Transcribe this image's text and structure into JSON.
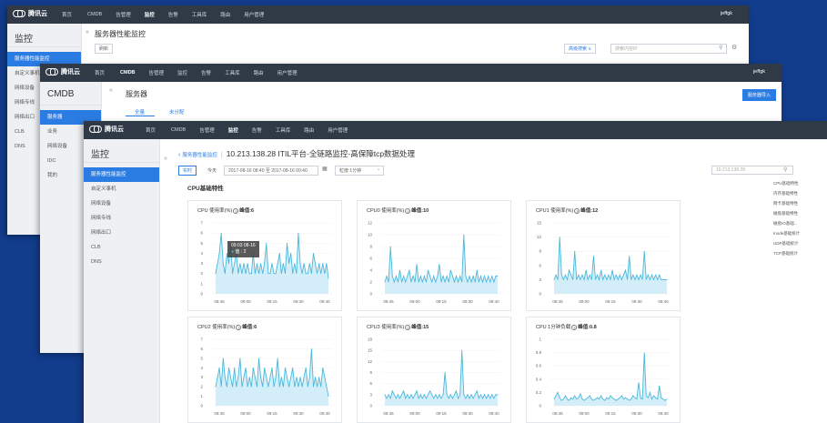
{
  "brand": "腾讯云",
  "user": "jeffgk",
  "nav_back": [
    "首页",
    "CMDB",
    "告管理",
    "监控",
    "告警",
    "工具库",
    "路由",
    "用户管理"
  ],
  "nav_mid": [
    "首页",
    "CMDB",
    "告管理",
    "监控",
    "告警",
    "工具库",
    "路由",
    "用户管理"
  ],
  "nav_front": [
    "首页",
    "CMDB",
    "告管理",
    "监控",
    "告警",
    "工具库",
    "路由",
    "用户管理"
  ],
  "back_win": {
    "sidebar_title": "监控",
    "sidebar_items": [
      "服务器性能监控",
      "自定义事机",
      "网络设备",
      "网络专线",
      "网络出口",
      "CLB",
      "DNS"
    ],
    "page_title": "服务器性能监控",
    "refresh_label": "刷新",
    "filter_label": "高级搜索 ∨",
    "search_placeholder": "搜索内容IP"
  },
  "mid_win": {
    "sidebar_title": "CMDB",
    "sidebar_items": [
      "服务器",
      "业务",
      "网络设备",
      "IDC",
      "我的"
    ],
    "page_title": "服务器",
    "tabs": [
      "全量",
      "未分配"
    ],
    "import_label": "服务器导入"
  },
  "front_win": {
    "sidebar_title": "监控",
    "sidebar_items": [
      "服务器性能监控",
      "自定义事机",
      "网络设备",
      "网络专线",
      "网络出口",
      "CLB",
      "DNS"
    ],
    "breadcrumb_link": "服务器性能监控",
    "breadcrumb_sep": "|",
    "heading": "10.213.138.28 ITIL平台-全链路监控-高保障tcp数据处理",
    "realtime_label": "实时",
    "today_label": "今天",
    "time_range": "2017-08-16 08:40 至 2017-08-16 09:40",
    "granularity": "粒度:1分钟",
    "ip_search_placeholder": "10.213.138.28",
    "section_title": "CPU基础特性",
    "right_links": [
      "CPU基础特性",
      "内存基础特性",
      "网卡基础特性",
      "磁盘基础特性",
      "磁盘IO基础...",
      "Inode基础统计",
      "UDP基础统计",
      "TCP基础统计"
    ],
    "tooltip": {
      "time": "09:03 08-16",
      "series": "值",
      "value": "2"
    }
  },
  "colors": {
    "accent": "#2b7ce2",
    "line": "#4ab8dc",
    "area": "#d3eef8",
    "topbar": "#2f3a46",
    "background": "#123c8c"
  },
  "chart_data": [
    {
      "type": "area",
      "title": "CPU 使用率(%)",
      "peak_label": "峰值:6",
      "x_ticks": [
        "08:45",
        "09:00",
        "09:15",
        "09:30",
        "09:40"
      ],
      "y_ticks": [
        "0",
        "1",
        "2",
        "3",
        "4",
        "5",
        "6",
        "7"
      ],
      "ylim": [
        0,
        7
      ],
      "values": [
        2,
        3,
        4,
        6,
        3,
        2,
        4,
        3,
        5,
        2,
        3,
        4,
        2,
        3,
        2,
        3,
        2,
        3,
        2,
        2,
        4,
        2,
        3,
        2,
        3,
        2,
        3,
        5,
        2,
        2,
        3,
        2,
        2,
        3,
        4,
        2,
        3,
        2,
        5,
        3,
        4,
        2,
        3,
        2,
        6,
        3,
        2,
        3,
        2,
        2,
        3,
        2,
        4,
        3,
        2,
        3,
        2,
        3,
        2,
        3,
        1.5
      ]
    },
    {
      "type": "area",
      "title": "CPU0 使用率(%)",
      "peak_label": "峰值:10",
      "x_ticks": [
        "08:45",
        "09:00",
        "09:15",
        "09:30",
        "09:40"
      ],
      "y_ticks": [
        "0",
        "2",
        "4",
        "6",
        "8",
        "10",
        "12"
      ],
      "ylim": [
        0,
        12
      ],
      "values": [
        2,
        3,
        2,
        8,
        3,
        2,
        3,
        2,
        4,
        2,
        3,
        2,
        3,
        4,
        2,
        3,
        2,
        5,
        2,
        3,
        2,
        3,
        2,
        4,
        3,
        2,
        3,
        2,
        3,
        5,
        2,
        3,
        2,
        3,
        2,
        4,
        3,
        2,
        3,
        2,
        3,
        2,
        10,
        3,
        2,
        3,
        2,
        3,
        2,
        4,
        2,
        3,
        2,
        3,
        2,
        3,
        2,
        3,
        2,
        3,
        3
      ]
    },
    {
      "type": "area",
      "title": "CPU1 使用率(%)",
      "peak_label": "峰值:12",
      "x_ticks": [
        "08:45",
        "09:00",
        "09:15",
        "09:30",
        "09:40"
      ],
      "y_ticks": [
        "0",
        "3",
        "6",
        "9",
        "12",
        "15"
      ],
      "ylim": [
        0,
        15
      ],
      "values": [
        3,
        4,
        3,
        12,
        4,
        3,
        4,
        3,
        5,
        4,
        3,
        9,
        3,
        4,
        3,
        4,
        3,
        5,
        3,
        4,
        3,
        8,
        3,
        4,
        3,
        5,
        3,
        4,
        3,
        4,
        3,
        5,
        3,
        4,
        3,
        4,
        3,
        4,
        5,
        3,
        8,
        3,
        4,
        3,
        4,
        3,
        4,
        3,
        9,
        3,
        4,
        3,
        4,
        3,
        4,
        3,
        4,
        3,
        3,
        3,
        3
      ]
    },
    {
      "type": "area",
      "title": "CPU2 使用率(%)",
      "peak_label": "峰值:6",
      "x_ticks": [
        "08:45",
        "09:00",
        "09:15",
        "09:30",
        "09:40"
      ],
      "y_ticks": [
        "0",
        "1",
        "2",
        "3",
        "4",
        "5",
        "6",
        "7"
      ],
      "ylim": [
        0,
        7
      ],
      "values": [
        2,
        3,
        4,
        2,
        5,
        3,
        2,
        4,
        3,
        2,
        4,
        2,
        3,
        5,
        2,
        3,
        4,
        2,
        3,
        2,
        4,
        3,
        2,
        5,
        3,
        2,
        4,
        3,
        2,
        3,
        4,
        2,
        3,
        5,
        2,
        3,
        2,
        4,
        3,
        2,
        3,
        4,
        2,
        3,
        2,
        3,
        2,
        3,
        4,
        2,
        3,
        6,
        2,
        3,
        2,
        3,
        2,
        4,
        3,
        2,
        1
      ]
    },
    {
      "type": "area",
      "title": "CPU3 使用率(%)",
      "peak_label": "峰值:15",
      "x_ticks": [
        "08:45",
        "09:00",
        "09:15",
        "09:30",
        "09:40"
      ],
      "y_ticks": [
        "0",
        "3",
        "6",
        "9",
        "12",
        "15",
        "18"
      ],
      "ylim": [
        0,
        18
      ],
      "values": [
        3,
        2,
        3,
        2,
        4,
        3,
        2,
        3,
        2,
        3,
        4,
        2,
        3,
        2,
        3,
        2,
        3,
        4,
        2,
        3,
        2,
        3,
        2,
        3,
        4,
        3,
        2,
        3,
        2,
        3,
        2,
        3,
        9,
        3,
        2,
        3,
        2,
        3,
        4,
        2,
        3,
        15,
        3,
        2,
        3,
        2,
        3,
        2,
        3,
        4,
        2,
        3,
        2,
        3,
        2,
        3,
        2,
        3,
        2,
        3,
        3
      ]
    },
    {
      "type": "area",
      "title": "CPU 1分钟负载",
      "peak_label": "峰值:0.8",
      "x_ticks": [
        "08:45",
        "09:00",
        "09:15",
        "09:30",
        "09:40"
      ],
      "y_ticks": [
        "0",
        "0.2",
        "0.4",
        "0.6",
        "0.8",
        "1"
      ],
      "ylim": [
        0,
        1
      ],
      "values": [
        0.1,
        0.15,
        0.2,
        0.12,
        0.08,
        0.1,
        0.15,
        0.1,
        0.08,
        0.12,
        0.1,
        0.15,
        0.1,
        0.12,
        0.18,
        0.1,
        0.08,
        0.1,
        0.12,
        0.15,
        0.1,
        0.08,
        0.1,
        0.12,
        0.1,
        0.15,
        0.1,
        0.08,
        0.12,
        0.1,
        0.15,
        0.12,
        0.1,
        0.08,
        0.1,
        0.12,
        0.15,
        0.1,
        0.12,
        0.1,
        0.08,
        0.1,
        0.15,
        0.12,
        0.1,
        0.35,
        0.12,
        0.1,
        0.8,
        0.15,
        0.12,
        0.2,
        0.1,
        0.15,
        0.12,
        0.1,
        0.3,
        0.12,
        0.1,
        0.08,
        0.1
      ]
    }
  ]
}
